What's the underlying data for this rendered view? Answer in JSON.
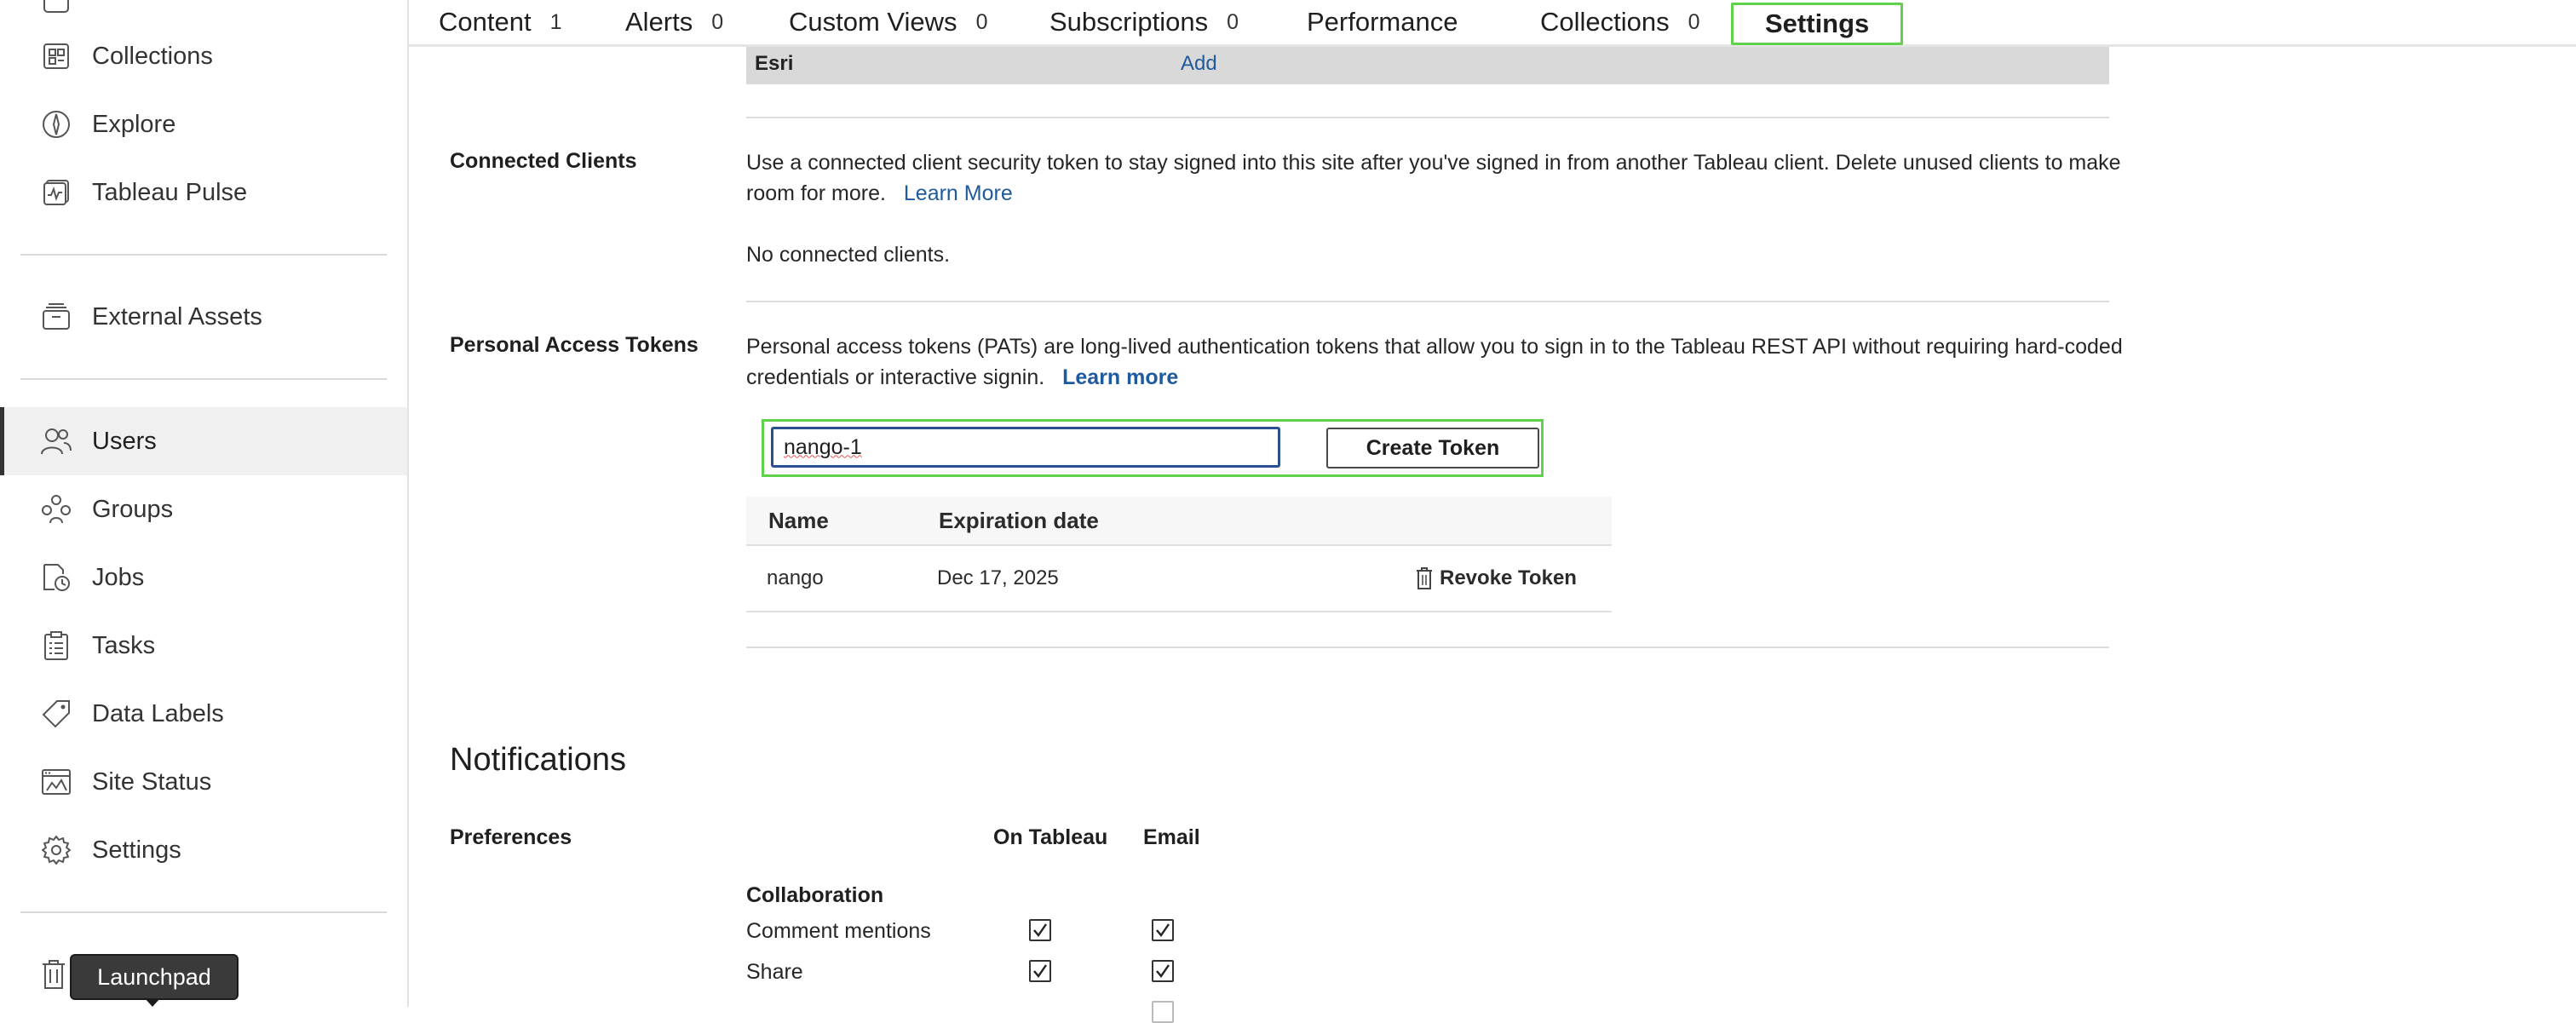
{
  "sidebar": {
    "items": [
      {
        "label": "Collections",
        "icon": "collections-icon"
      },
      {
        "label": "Explore",
        "icon": "explore-icon"
      },
      {
        "label": "Tableau Pulse",
        "icon": "pulse-icon"
      },
      {
        "label": "External Assets",
        "icon": "external-assets-icon"
      },
      {
        "label": "Users",
        "icon": "users-icon",
        "active": true
      },
      {
        "label": "Groups",
        "icon": "groups-icon"
      },
      {
        "label": "Jobs",
        "icon": "jobs-icon"
      },
      {
        "label": "Tasks",
        "icon": "tasks-icon"
      },
      {
        "label": "Data Labels",
        "icon": "data-labels-icon"
      },
      {
        "label": "Site Status",
        "icon": "site-status-icon"
      },
      {
        "label": "Settings",
        "icon": "settings-icon"
      }
    ],
    "tooltip": "Launchpad"
  },
  "tabs": [
    {
      "label": "Content",
      "count": "1"
    },
    {
      "label": "Alerts",
      "count": "0"
    },
    {
      "label": "Custom Views",
      "count": "0"
    },
    {
      "label": "Subscriptions",
      "count": "0"
    },
    {
      "label": "Performance",
      "count": ""
    },
    {
      "label": "Collections",
      "count": "0"
    },
    {
      "label": "Settings",
      "count": "",
      "selected": true
    }
  ],
  "esri": {
    "name": "Esri",
    "action": "Add"
  },
  "connected_clients": {
    "title": "Connected Clients",
    "description_line1": "Use a connected client security token to stay signed into this site after you've signed in from another Tableau client. Delete unused clients to make",
    "description_line2": "room for more.",
    "learn_more": "Learn More",
    "empty": "No connected clients."
  },
  "pat": {
    "title": "Personal Access Tokens",
    "description_line1": "Personal access tokens (PATs) are long-lived authentication tokens that allow you to sign in to the Tableau REST API without requiring hard-coded",
    "description_line2": "credentials or interactive signin.",
    "learn_more": "Learn more",
    "input_value": "nango-1",
    "create_label": "Create Token",
    "columns": [
      "Name",
      "Expiration date"
    ],
    "rows": [
      {
        "name": "nango",
        "expiration": "Dec 17, 2025",
        "action": "Revoke Token"
      }
    ]
  },
  "notifications": {
    "heading": "Notifications",
    "preferences_label": "Preferences",
    "col_on_tableau": "On Tableau",
    "col_email": "Email",
    "group": "Collaboration",
    "items": [
      {
        "label": "Comment mentions",
        "on_tableau": true,
        "email": true
      },
      {
        "label": "Share",
        "on_tableau": true,
        "email": true
      }
    ]
  },
  "colors": {
    "accent_green": "#5fd14a",
    "link_blue": "#1f5a9e",
    "input_border": "#2a4f93"
  }
}
